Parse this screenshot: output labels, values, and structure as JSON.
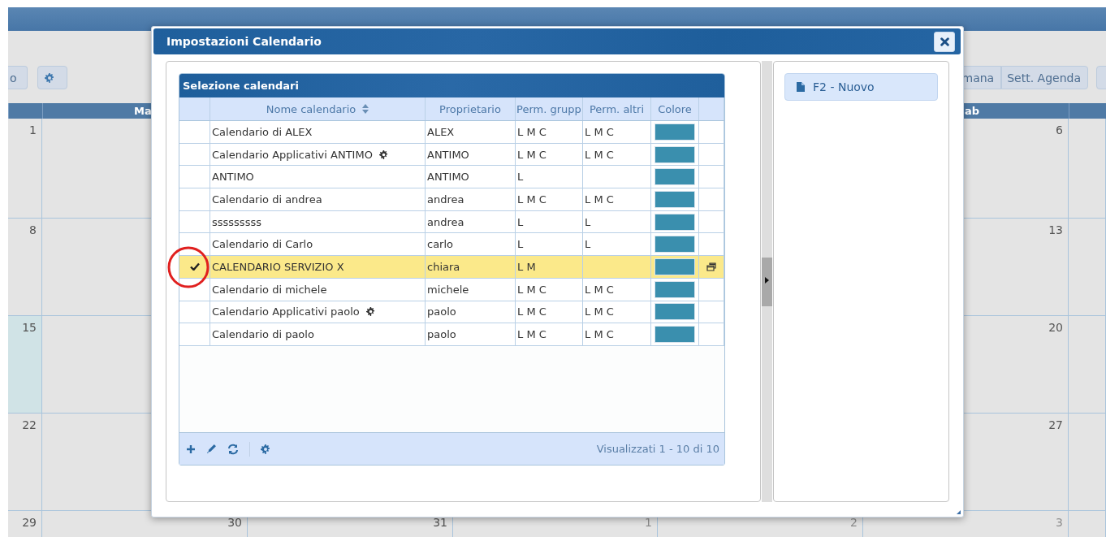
{
  "background": {
    "toolbar_left": [
      {
        "kind": "text",
        "label": "o"
      },
      {
        "kind": "gear"
      }
    ],
    "toolbar_right": [
      {
        "kind": "text",
        "label": "mana"
      },
      {
        "kind": "text",
        "label": "Sett. Agenda"
      },
      {
        "kind": "blank"
      }
    ],
    "weekday_headers": [
      "Ma",
      "ab"
    ],
    "weeks": [
      {
        "cells": [
          {
            "day": "1",
            "today": false,
            "other_month": false
          },
          {},
          {},
          {},
          {},
          {
            "day": "6",
            "today": false,
            "other_month": false
          },
          {}
        ]
      },
      {
        "cells": [
          {
            "day": "8",
            "today": false,
            "other_month": false
          },
          {},
          {},
          {},
          {},
          {
            "day": "13",
            "today": false,
            "other_month": false
          },
          {}
        ]
      },
      {
        "cells": [
          {
            "day": "15",
            "today": true,
            "other_month": false
          },
          {},
          {},
          {},
          {},
          {
            "day": "20",
            "today": false,
            "other_month": false
          },
          {}
        ]
      },
      {
        "cells": [
          {
            "day": "22",
            "today": false,
            "other_month": false
          },
          {},
          {},
          {},
          {},
          {
            "day": "27",
            "today": false,
            "other_month": false
          },
          {}
        ]
      },
      {
        "cells": [
          {
            "day": "29",
            "today": false,
            "other_month": false
          },
          {
            "day": "30",
            "today": false,
            "other_month": false
          },
          {
            "day": "31",
            "today": false,
            "other_month": false
          },
          {
            "day": "1",
            "today": false,
            "other_month": true
          },
          {
            "day": "2",
            "today": false,
            "other_month": true
          },
          {
            "day": "3",
            "today": false,
            "other_month": true
          },
          {}
        ]
      }
    ]
  },
  "dialog": {
    "title": "Impostazioni Calendario",
    "grid": {
      "caption": "Selezione calendari",
      "columns": [
        {
          "label": "Nome calendario",
          "sorted": true
        },
        {
          "label": "Proprietario",
          "sorted": false
        },
        {
          "label": "Perm. grupp",
          "sorted": false
        },
        {
          "label": "Perm. altri",
          "sorted": false
        },
        {
          "label": "Colore",
          "sorted": false
        }
      ],
      "rows": [
        {
          "name": "Calendario di ALEX",
          "has_settings": false,
          "owner": "ALEX",
          "group_perms": "L M C",
          "other_perms": "L M C",
          "color": "#3a8fae",
          "selected": false
        },
        {
          "name": "Calendario Applicativi ANTIMO",
          "has_settings": true,
          "owner": "ANTIMO",
          "group_perms": "L M C",
          "other_perms": "L M C",
          "color": "#3a8fae",
          "selected": false
        },
        {
          "name": "ANTIMO",
          "has_settings": false,
          "owner": "ANTIMO",
          "group_perms": "L",
          "color": "#3a8fae",
          "selected": false
        },
        {
          "name": "Calendario di andrea",
          "has_settings": false,
          "owner": "andrea",
          "group_perms": "L M C",
          "other_perms": "L M C",
          "color": "#3a8fae",
          "selected": false
        },
        {
          "name": "sssssssss",
          "has_settings": false,
          "owner": "andrea",
          "group_perms": "L",
          "other_perms": "L",
          "color": "#3a8fae",
          "selected": false
        },
        {
          "name": "Calendario di Carlo",
          "has_settings": false,
          "owner": "carlo",
          "group_perms": "L",
          "other_perms": "L",
          "color": "#3a8fae",
          "selected": false
        },
        {
          "name": "CALENDARIO SERVIZIO X",
          "has_settings": false,
          "owner": "chiara",
          "group_perms": "L M",
          "color": "#3a8fae",
          "selected": true
        },
        {
          "name": "Calendario di michele",
          "has_settings": false,
          "owner": "michele",
          "group_perms": "L M C",
          "other_perms": "L M C",
          "color": "#3a8fae",
          "selected": false
        },
        {
          "name": "Calendario Applicativi paolo",
          "has_settings": true,
          "owner": "paolo",
          "group_perms": "L M C",
          "other_perms": "L M C",
          "color": "#3a8fae",
          "selected": false
        },
        {
          "name": "Calendario di paolo",
          "has_settings": false,
          "owner": "paolo",
          "group_perms": "L M C",
          "other_perms": "L M C",
          "color": "#3a8fae",
          "selected": false
        }
      ],
      "footer_tools": [
        {
          "kind": "add"
        },
        {
          "kind": "edit"
        },
        {
          "kind": "refresh"
        },
        {
          "kind": "separator"
        },
        {
          "kind": "settings"
        }
      ],
      "pager": "Visualizzati 1 - 10 di 10"
    },
    "side_actions": [
      {
        "kind": "new",
        "label": "F2 - Nuovo"
      }
    ]
  },
  "annotation": {
    "color": "#e0201f"
  }
}
